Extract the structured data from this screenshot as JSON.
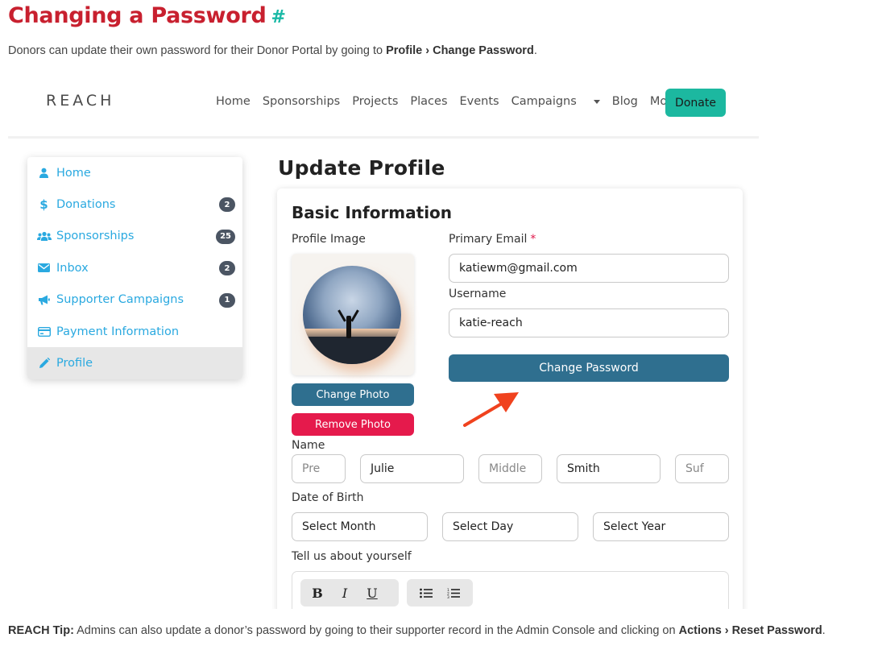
{
  "doc": {
    "title": "Changing a Password",
    "anchor": "#",
    "intro_pre": "Donors can update their own password for their Donor Portal by going to ",
    "intro_path": "Profile › Change Password",
    "intro_post": ".",
    "tip_label": "REACH Tip:",
    "tip_text": " Admins can also update a donor’s password by going to their supporter record in the Admin Console and clicking on ",
    "tip_path": "Actions › Reset Password",
    "tip_end": "."
  },
  "site": {
    "logo": "REACH",
    "nav": [
      "Home",
      "Sponsorships",
      "Projects",
      "Places",
      "Events",
      "Campaigns",
      "Blog",
      "More"
    ],
    "donate_label": "Donate"
  },
  "sidebar": {
    "items": [
      {
        "label": "Home",
        "icon": "user-icon",
        "badge": ""
      },
      {
        "label": "Donations",
        "icon": "dollar-icon",
        "badge": "2"
      },
      {
        "label": "Sponsorships",
        "icon": "users-icon",
        "badge": "25"
      },
      {
        "label": "Inbox",
        "icon": "envelope-icon",
        "badge": "2"
      },
      {
        "label": "Supporter Campaigns",
        "icon": "megaphone-icon",
        "badge": "1"
      },
      {
        "label": "Payment Information",
        "icon": "credit-card-icon",
        "badge": ""
      },
      {
        "label": "Profile",
        "icon": "pencil-icon",
        "badge": ""
      }
    ],
    "active": "Profile"
  },
  "profile": {
    "heading": "Update Profile",
    "section_title": "Basic Information",
    "profile_image_label": "Profile Image",
    "primary_email_label": "Primary Email",
    "required_mark": "*",
    "email_value": "katiewm@gmail.com",
    "username_label": "Username",
    "username_value": "katie-reach",
    "change_password_label": "Change Password",
    "change_photo_label": "Change Photo",
    "remove_photo_label": "Remove Photo",
    "name_label": "Name",
    "name_prefix_placeholder": "Pre",
    "first_name_value": "Julie",
    "middle_placeholder": "Middle",
    "last_name_value": "Smith",
    "suffix_placeholder": "Suf",
    "dob_label": "Date of Birth",
    "month_value": "Select Month",
    "day_value": "Select Day",
    "year_value": "Select Year",
    "about_label": "Tell us about yourself",
    "editor_buttons": [
      "B",
      "I",
      "U"
    ]
  },
  "colors": {
    "title_red": "#c8202f",
    "anchor_teal": "#1ab9a6",
    "donate_teal": "#1cb8a0",
    "sidebar_blue": "#2aa9e0",
    "primary_button": "#2f6f8f",
    "danger_button": "#e51a4c",
    "arrow": "#f0421e"
  }
}
